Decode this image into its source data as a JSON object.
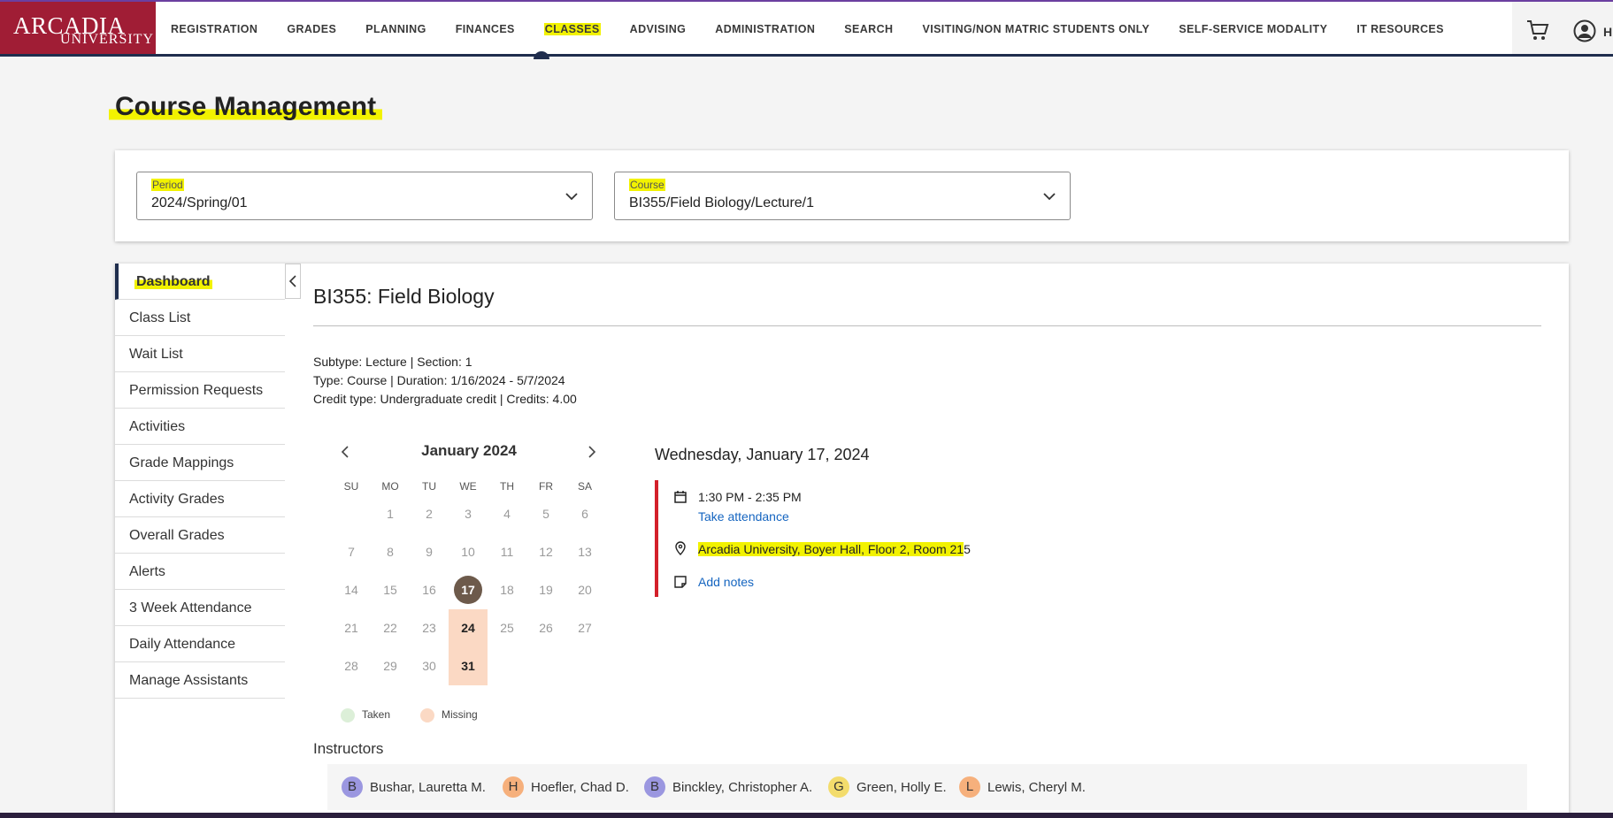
{
  "brand": {
    "line1": "ARCADIA",
    "line2": "UNIVERSITY"
  },
  "nav": {
    "items": [
      {
        "label": "REGISTRATION"
      },
      {
        "label": "GRADES"
      },
      {
        "label": "PLANNING"
      },
      {
        "label": "FINANCES"
      },
      {
        "label": "CLASSES",
        "active": true
      },
      {
        "label": "ADVISING"
      },
      {
        "label": "ADMINISTRATION"
      },
      {
        "label": "SEARCH"
      },
      {
        "label": "VISITING/NON MATRIC STUDENTS ONLY"
      },
      {
        "label": "SELF-SERVICE MODALITY"
      },
      {
        "label": "IT RESOURCES"
      }
    ],
    "cart_icon": "cart-icon",
    "user_icon": "user-circle-icon",
    "user_initial": "H"
  },
  "page": {
    "title": "Course Management"
  },
  "filters": {
    "period": {
      "label": "Period",
      "value": "2024/Spring/01"
    },
    "course": {
      "label": "Course",
      "value": "BI355/Field Biology/Lecture/1"
    }
  },
  "sidebar": {
    "items": [
      {
        "label": "Dashboard",
        "active": true
      },
      {
        "label": "Class List"
      },
      {
        "label": "Wait List"
      },
      {
        "label": "Permission Requests"
      },
      {
        "label": "Activities"
      },
      {
        "label": "Grade Mappings"
      },
      {
        "label": "Activity Grades"
      },
      {
        "label": "Overall Grades"
      },
      {
        "label": "Alerts"
      },
      {
        "label": "3 Week Attendance"
      },
      {
        "label": "Daily Attendance"
      },
      {
        "label": "Manage Assistants"
      }
    ]
  },
  "course": {
    "title": "BI355: Field Biology",
    "meta_line1": "Subtype: Lecture | Section: 1",
    "meta_line2": "Type: Course | Duration: 1/16/2024 - 5/7/2024",
    "meta_line3": "Credit type: Undergraduate credit | Credits: 4.00"
  },
  "calendar": {
    "month": "January 2024",
    "weekdays": [
      "SU",
      "MO",
      "TU",
      "WE",
      "TH",
      "FR",
      "SA"
    ],
    "weeks": [
      [
        "",
        "1",
        "2",
        "3",
        "4",
        "5",
        "6"
      ],
      [
        "7",
        "8",
        "9",
        "10",
        "11",
        "12",
        "13"
      ],
      [
        "14",
        "15",
        "16",
        "17",
        "18",
        "19",
        "20"
      ],
      [
        "21",
        "22",
        "23",
        "24",
        "25",
        "26",
        "27"
      ],
      [
        "28",
        "29",
        "30",
        "31",
        "",
        "",
        ""
      ]
    ],
    "today": "17",
    "missing": [
      "24",
      "31"
    ],
    "legend": {
      "taken": "Taken",
      "missing": "Missing"
    },
    "colors": {
      "taken": "#dcefd8",
      "missing": "#fbd9c4",
      "today": "#6d5a4b"
    }
  },
  "detail": {
    "date": "Wednesday, January 17, 2024",
    "time": "1:30 PM - 2:35 PM",
    "take_attendance": "Take attendance",
    "location_hl": "Arcadia University, Boyer Hall, Floor 2, Room 21",
    "location_rest": "5",
    "add_notes": "Add notes"
  },
  "instructors": {
    "title": "Instructors",
    "people": [
      {
        "initial": "B",
        "name": "Bushar, Lauretta M.",
        "color": "#9b97e0"
      },
      {
        "initial": "H",
        "name": "Hoefler, Chad D.",
        "color": "#f6b07c"
      },
      {
        "initial": "B",
        "name": "Binckley, Christopher A.",
        "color": "#9b97e0"
      },
      {
        "initial": "G",
        "name": "Green, Holly E.",
        "color": "#f3dc6c"
      },
      {
        "initial": "L",
        "name": "Lewis, Cheryl M.",
        "color": "#f6b07c"
      }
    ]
  }
}
